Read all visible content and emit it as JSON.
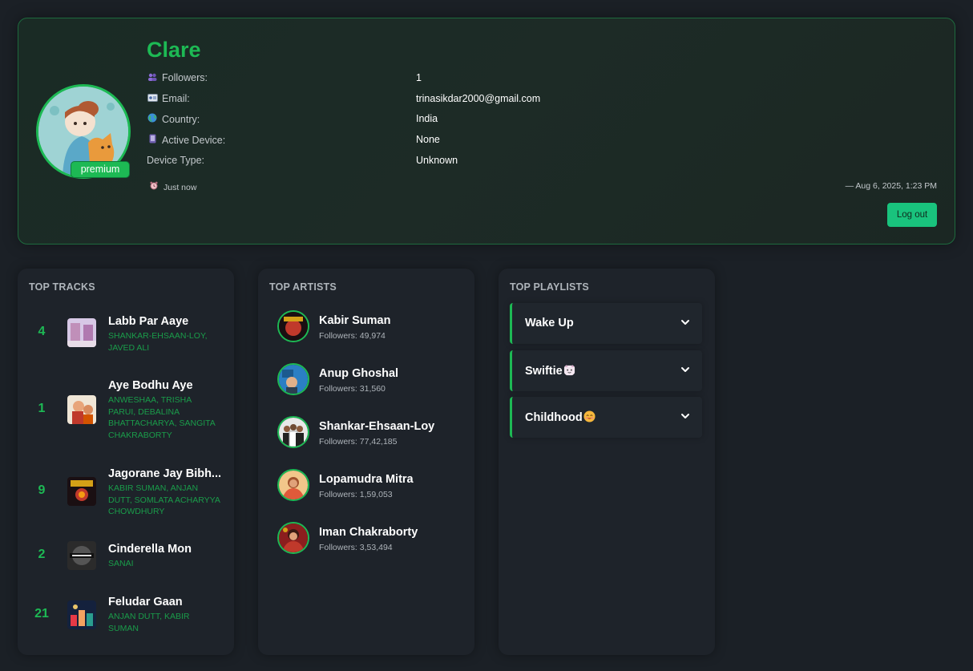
{
  "profile": {
    "name": "Clare",
    "badge": "premium",
    "followers_label": "Followers:",
    "followers_value": "1",
    "email_label": "Email:",
    "email_value": "trinasikdar2000@gmail.com",
    "country_label": "Country:",
    "country_value": "India",
    "device_label": "Active Device:",
    "device_value": "None",
    "device_type_label": "Device Type:",
    "device_type_value": "Unknown",
    "time_ago": "Just now",
    "timestamp": "— Aug 6, 2025, 1:23 PM",
    "logout_label": "Log out"
  },
  "top_tracks": {
    "title": "TOP TRACKS",
    "items": [
      {
        "rank": "4",
        "title": "Labb Par Aaye",
        "artists": "SHANKAR-EHSAAN-LOY, JAVED ALI"
      },
      {
        "rank": "1",
        "title": "Aye Bodhu Aye",
        "artists": "ANWESHAA, TRISHA PARUI, DEBALINA BHATTACHARYA, SANGITA CHAKRABORTY"
      },
      {
        "rank": "9",
        "title": "Jagorane Jay Bibh...",
        "artists": "KABIR SUMAN, ANJAN DUTT, SOMLATA ACHARYYA CHOWDHURY"
      },
      {
        "rank": "2",
        "title": "Cinderella Mon",
        "artists": "SANAI"
      },
      {
        "rank": "21",
        "title": "Feludar Gaan",
        "artists": "ANJAN DUTT, KABIR SUMAN"
      }
    ]
  },
  "top_artists": {
    "title": "TOP ARTISTS",
    "items": [
      {
        "name": "Kabir Suman",
        "followers": "Followers: 49,974"
      },
      {
        "name": "Anup Ghoshal",
        "followers": "Followers: 31,560"
      },
      {
        "name": "Shankar-Ehsaan-Loy",
        "followers": "Followers: 77,42,185"
      },
      {
        "name": "Lopamudra Mitra",
        "followers": "Followers: 1,59,053"
      },
      {
        "name": "Iman Chakraborty",
        "followers": "Followers: 3,53,494"
      }
    ]
  },
  "top_playlists": {
    "title": "TOP PLAYLISTS",
    "items": [
      {
        "name": "Wake Up",
        "emoji": ""
      },
      {
        "name": "Swiftie",
        "emoji": "cat-face-emoji"
      },
      {
        "name": "Childhood",
        "emoji": "smiling-face-emoji"
      }
    ]
  },
  "colors": {
    "accent": "#1db954",
    "background": "#1b2026",
    "panel": "#1e232a",
    "logout_button": "#19c37d"
  }
}
